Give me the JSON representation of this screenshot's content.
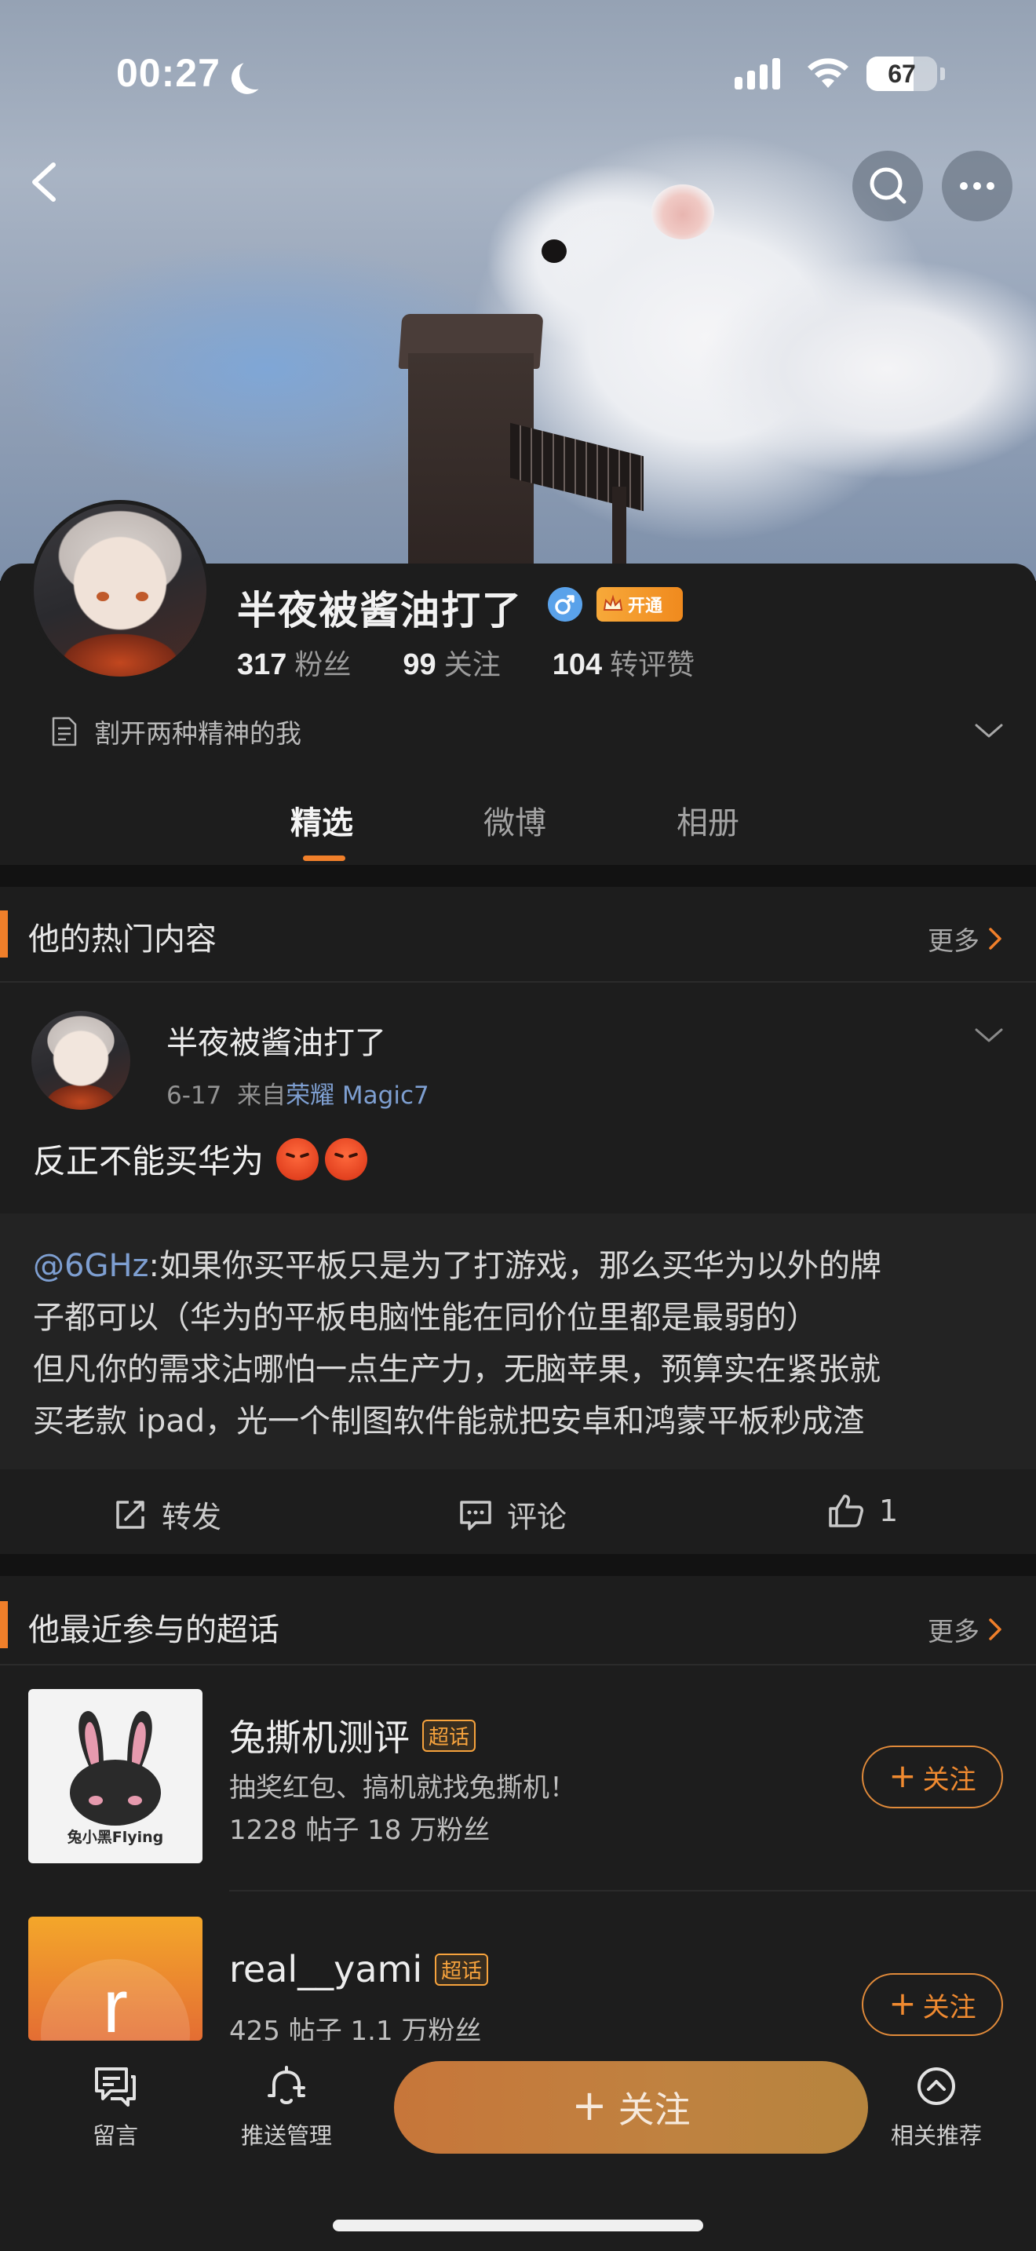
{
  "status_bar": {
    "time": "00:27",
    "battery": "67",
    "battery_level": 0.67
  },
  "profile": {
    "name": "半夜被酱油打了",
    "vip_label": "开通",
    "stats": [
      {
        "num": "317",
        "label": "粉丝"
      },
      {
        "num": "99",
        "label": "关注"
      },
      {
        "num": "104",
        "label": "转评赞"
      }
    ],
    "bio": "割开两种精神的我"
  },
  "tabs": [
    "精选",
    "微博",
    "相册"
  ],
  "hot_section": {
    "title": "他的热门内容",
    "more": "更多",
    "post": {
      "author": "半夜被酱油打了",
      "date": "6-17",
      "from_prefix": "来自",
      "source": "荣耀 Magic7",
      "text": "反正不能买华为",
      "quote_mention": "@6GHz",
      "quote_lines": [
        ":如果你买平板只是为了打游戏，那么买华为以外的牌",
        "子都可以（华为的平板电脑性能在同价位里都是最弱的）",
        "但凡你的需求沾哪怕一点生产力，无脑苹果，预算实在紧张就",
        "买老款 ipad，光一个制图软件能就把安卓和鸿蒙平板秒成渣"
      ],
      "actions": {
        "repost": "转发",
        "comment": "评论",
        "like_count": "1"
      }
    }
  },
  "topics_section": {
    "title": "他最近参与的超话",
    "more": "更多",
    "items": [
      {
        "name": "兔撕机测评",
        "tag": "超话",
        "desc": "抽奖红包、搞机就找兔撕机！",
        "count": "1228 帖子 18 万粉丝",
        "thumb_text": "兔小黑Flying",
        "follow": "关注"
      },
      {
        "name": "real__yami",
        "tag": "超话",
        "count": "425 帖子 1.1 万粉丝",
        "thumb_text": "r",
        "follow": "关注"
      }
    ]
  },
  "bottom_bar": {
    "message": "留言",
    "push": "推送管理",
    "follow": "关注",
    "related": "相关推荐"
  },
  "colors": {
    "accent": "#f07f2a",
    "link": "#7e9fd1",
    "background": "#1d1d1d"
  }
}
